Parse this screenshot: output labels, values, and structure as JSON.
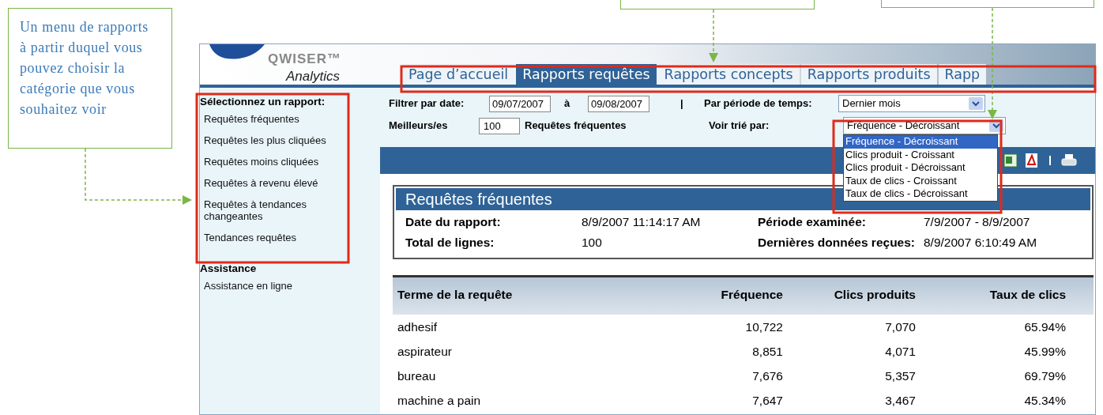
{
  "callouts": [
    {
      "text": "Un menu de rapports à partir duquel vous pouvez choisir la catégorie que vous souhaitez voir"
    }
  ],
  "logo": {
    "name": "QWISER™",
    "subtitle": "Analytics"
  },
  "tabs": [
    {
      "label": "Page d’accueil",
      "selected": false
    },
    {
      "label": "Rapports requêtes",
      "selected": true
    },
    {
      "label": "Rapports concepts",
      "selected": false
    },
    {
      "label": "Rapports produits",
      "selected": false
    },
    {
      "label": "Rapp",
      "selected": false
    }
  ],
  "sidebar": [
    {
      "heading": "Sélectionnez un rapport:",
      "items": [
        "Requêtes fréquentes",
        "Requêtes les plus cliquées",
        "Requêtes moins cliquées",
        "Requêtes à revenu élevé",
        "Requêtes à tendances changeantes",
        "Tendances requêtes"
      ]
    },
    {
      "heading": "Assistance",
      "items": [
        "Assistance en ligne"
      ]
    }
  ],
  "filters": {
    "date_label": "Filtrer par date:",
    "date_from": "09/07/2007",
    "to_label": "à",
    "date_to": "09/08/2007",
    "separator": "|",
    "period_label": "Par période de temps:",
    "period_value": "Dernier mois",
    "top_label": "Meilleurs/es",
    "top_value": "100",
    "top_suffix": "Requêtes fréquentes",
    "sort_label": "Voir trié par:",
    "sort_value": "Fréquence - Décroissant",
    "sort_expanded": true,
    "sort_options": [
      {
        "label": "Fréquence - Décroissant",
        "selected": true
      },
      {
        "label": "Clics produit - Croissant",
        "selected": false
      },
      {
        "label": "Clics produit - Décroissant",
        "selected": false
      },
      {
        "label": "Taux de clics - Croissant",
        "selected": false
      },
      {
        "label": "Taux de clics - Décroissant",
        "selected": false
      }
    ]
  },
  "report": {
    "title": "Requêtes fréquentes",
    "fields": [
      {
        "label": "Date du rapport:",
        "value": "8/9/2007 11:14:17 AM"
      },
      {
        "label": "Période examinée:",
        "value": "7/9/2007 - 8/9/2007"
      },
      {
        "label": "Total de lignes:",
        "value": "100"
      },
      {
        "label": "Dernières données reçues:",
        "value": "8/9/2007 6:10:49 AM"
      }
    ]
  },
  "table": {
    "columns": [
      "Terme de la requête",
      "Fréquence",
      "Clics produits",
      "Taux de clics"
    ],
    "rows": [
      [
        "adhesif",
        "10,722",
        "7,070",
        "65.94%"
      ],
      [
        "aspirateur",
        "8,851",
        "4,071",
        "45.99%"
      ],
      [
        "bureau",
        "7,676",
        "5,357",
        "69.79%"
      ],
      [
        "machine a pain",
        "7,647",
        "3,467",
        "45.34%"
      ]
    ]
  }
}
